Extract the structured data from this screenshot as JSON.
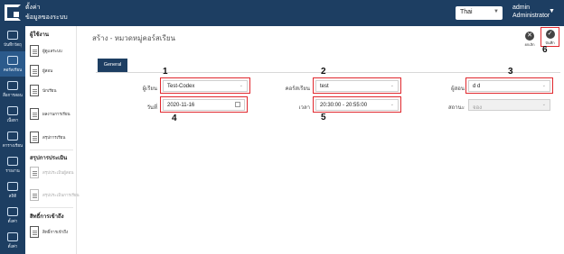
{
  "header": {
    "app_title_line1": "ตั้งค่า",
    "app_title_line2": "ข้อมูลของระบบ",
    "language": "Thai",
    "user_name": "admin",
    "user_role": "Administrator"
  },
  "rail": [
    {
      "label": "บันทึกวัตถุ"
    },
    {
      "label": "คอร์สเรียน"
    },
    {
      "label": "สื่อการสอน"
    },
    {
      "label": "เนื้อหา"
    },
    {
      "label": "ตารางเรียน"
    },
    {
      "label": "รายงาน"
    },
    {
      "label": "สถิติ"
    },
    {
      "label": "ตั้งค่า"
    },
    {
      "label": "ตั้งค่า"
    }
  ],
  "submenu": {
    "section1_title": "ผู้ใช้งาน",
    "section1_items": [
      "ผู้ดูแลระบบ",
      "ผู้สอน",
      "นักเรียน",
      "ผลงานการเรียน",
      "สรุปการเรียน"
    ],
    "section2_title": "สรุปการประเมิน",
    "section2_items": [
      "สรุปประเมินผู้สอน",
      "สรุปประเมินการเรียน"
    ],
    "section3_title": "สิทธิ์การเข้าถึง",
    "section3_items": [
      "สิทธิ์การเข้าถึง"
    ]
  },
  "main": {
    "title": "สร้าง - หมวดหมู่คอร์สเรียน",
    "cancel_label": "ยกเลิก",
    "save_label": "บันทึก",
    "tab_general": "General",
    "fields": {
      "student_label": "ผู้เรียน",
      "student_value": "Test-Codex",
      "course_label": "คอร์สเรียน",
      "course_value": "test",
      "teacher_label": "ผู้สอน",
      "teacher_value": "d d",
      "date_label": "วันที่",
      "date_value": "2020-11-16",
      "time_label": "เวลา",
      "time_value": "20:30:00 - 20:55:00",
      "status_label": "สถานะ",
      "status_value": "จอง"
    }
  },
  "annotations": [
    "1",
    "2",
    "3",
    "4",
    "5",
    "6"
  ],
  "colors": {
    "header_bg": "#1d3e62",
    "highlight": "#e0282e",
    "tab_bg": "#1d3e62"
  }
}
